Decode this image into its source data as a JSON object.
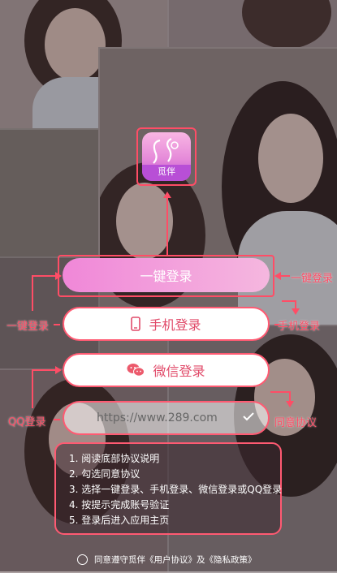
{
  "app": {
    "logo_text": "觅伴"
  },
  "buttons": {
    "one_click_login": "一键登录",
    "phone_login": "手机登录",
    "wechat_login": "微信登录",
    "url_text": "https://www.289.com"
  },
  "annotations": {
    "one_click_right": "一键登录",
    "one_click_left": "一键登录",
    "phone_right": "手机登录",
    "qq_left": "QQ登录",
    "agree_right": "同意协议"
  },
  "instructions": [
    "1. 阅读底部协议说明",
    "2. 勾选同意协议",
    "3. 选择一键登录、手机登录、微信登录或QQ登录",
    "4. 按提示完成账号验证",
    "5. 登录后进入应用主页"
  ],
  "agreement": "同意遵守觅伴《用户协议》及《隐私政策》",
  "colors": {
    "accent": "#ff4d66",
    "primary_gradient_start": "#f087d8",
    "primary_gradient_end": "#f5b7df"
  },
  "icons": [
    "phone-icon",
    "wechat-icon",
    "check-icon"
  ]
}
